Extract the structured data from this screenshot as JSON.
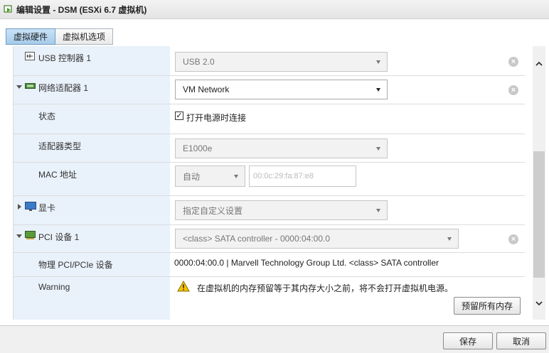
{
  "window": {
    "title": "编辑设置 - DSM (ESXi 6.7 虚拟机)"
  },
  "tabs": [
    {
      "label": "虚拟硬件",
      "active": true
    },
    {
      "label": "虚拟机选项",
      "active": false
    }
  ],
  "rows": {
    "usb": {
      "label": "USB 控制器 1",
      "value": "USB 2.0"
    },
    "nic": {
      "label": "网络适配器 1",
      "value": "VM Network"
    },
    "status": {
      "label": "状态",
      "checkbox_label": "打开电源时连接",
      "checked": true
    },
    "adapter_type": {
      "label": "适配器类型",
      "value": "E1000e"
    },
    "mac": {
      "label": "MAC 地址",
      "mode": "自动",
      "placeholder": "00:0c:29:fa:87:e8"
    },
    "video": {
      "label": "显卡",
      "value": "指定自定义设置"
    },
    "pci": {
      "label": "PCI 设备 1",
      "value": "<class> SATA controller - 0000:04:00.0"
    },
    "pci_physical": {
      "label": "物理 PCI/PCIe 设备",
      "value": "0000:04:00.0 | Marvell Technology Group Ltd. <class> SATA controller"
    },
    "warning": {
      "label": "Warning",
      "message": "在虚拟机的内存预留等于其内存大小之前，将不会打开虚拟机电源。",
      "button": "预留所有内存"
    }
  },
  "footer": {
    "save": "保存",
    "cancel": "取消"
  },
  "colors": {
    "label_bg": "#e9f1fa",
    "active_tab": "#a6cbea",
    "warning": "#f5c400"
  }
}
